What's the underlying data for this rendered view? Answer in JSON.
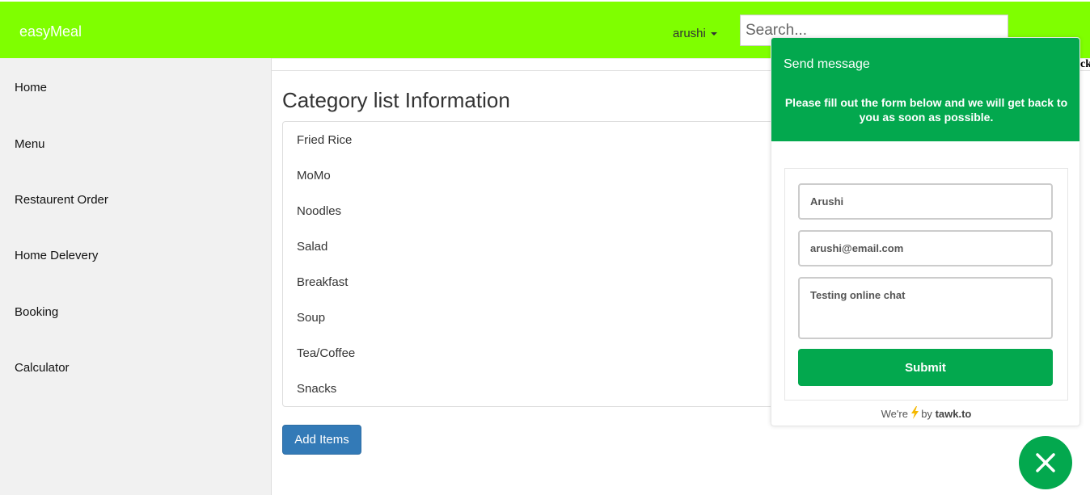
{
  "navbar": {
    "brand": "easyMeal",
    "user": "arushi",
    "search_placeholder": "Search..."
  },
  "sidebar": {
    "items": [
      {
        "label": "Home"
      },
      {
        "label": "Menu"
      },
      {
        "label": "Restaurent Order"
      },
      {
        "label": "Home Delevery"
      },
      {
        "label": "Booking"
      },
      {
        "label": "Calculator"
      }
    ]
  },
  "main": {
    "title": "Category list Information",
    "categories": [
      "Fried Rice",
      "MoMo",
      "Noodles",
      "Salad",
      "Breakfast",
      "Soup",
      "Tea/Coffee",
      "Snacks"
    ],
    "add_button": "Add Items",
    "clipped_text": "ck"
  },
  "chat": {
    "title": "Send message",
    "subtitle": "Please fill out the form below and we will get back to you as soon as possible.",
    "name_value": "Arushi",
    "email_value": "arushi@email.com",
    "message_value": "Testing online chat",
    "submit_label": "Submit",
    "powered_prefix": "We're",
    "powered_by": "by",
    "powered_brand": "tawk.to"
  },
  "colors": {
    "navbar": "#7fff00",
    "chat_green": "#03a84e",
    "primary_button": "#337ab7"
  },
  "icons": {
    "caret": "caret-down-icon",
    "bolt": "lightning-icon",
    "close": "close-icon"
  }
}
